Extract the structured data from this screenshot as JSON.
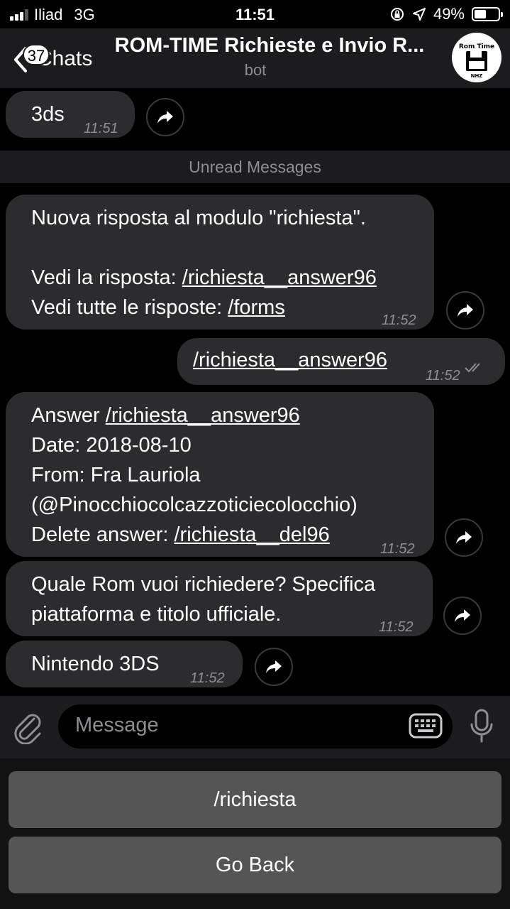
{
  "status_bar": {
    "carrier": "Iliad",
    "network": "3G",
    "time": "11:51",
    "battery_percent": "49%",
    "battery_level": 0.49
  },
  "nav": {
    "back_label": "Chats",
    "unread_count": "37",
    "title": "ROM-TIME Richieste e Invio R...",
    "subtitle": "bot",
    "avatar_top": "Rom Time",
    "avatar_bottom": "NHZ"
  },
  "chat": {
    "m1": {
      "text": "3ds",
      "time": "11:51"
    },
    "unread_label": "Unread Messages",
    "m2": {
      "l1": "Nuova risposta al modulo \"richiesta\".",
      "l2_prefix": "Vedi la risposta: ",
      "l2_cmd": "/richiesta__answer96",
      "l3_prefix": "Vedi tutte le risposte: ",
      "l3_cmd": "/forms",
      "time": "11:52"
    },
    "m3": {
      "cmd": "/richiesta__answer96",
      "time": "11:52"
    },
    "m4": {
      "l1_prefix": "Answer ",
      "l1_cmd": "/richiesta__answer96",
      "l2": "Date: 2018-08-10",
      "l3": "From: Fra Lauriola",
      "l4": "(@Pinocchiocolcazzoticiecolocchio)",
      "l5_prefix": "Delete answer: ",
      "l5_cmd": "/richiesta__del96",
      "time": "11:52"
    },
    "m5": {
      "l1": "Quale Rom vuoi richiedere? Specifica",
      "l2": "piattaforma e titolo ufficiale.",
      "time": "11:52"
    },
    "m6": {
      "text": "Nintendo 3DS",
      "time": "11:52"
    }
  },
  "input": {
    "placeholder": "Message"
  },
  "keyboard_buttons": {
    "b1": "/richiesta",
    "b2": "Go Back"
  }
}
